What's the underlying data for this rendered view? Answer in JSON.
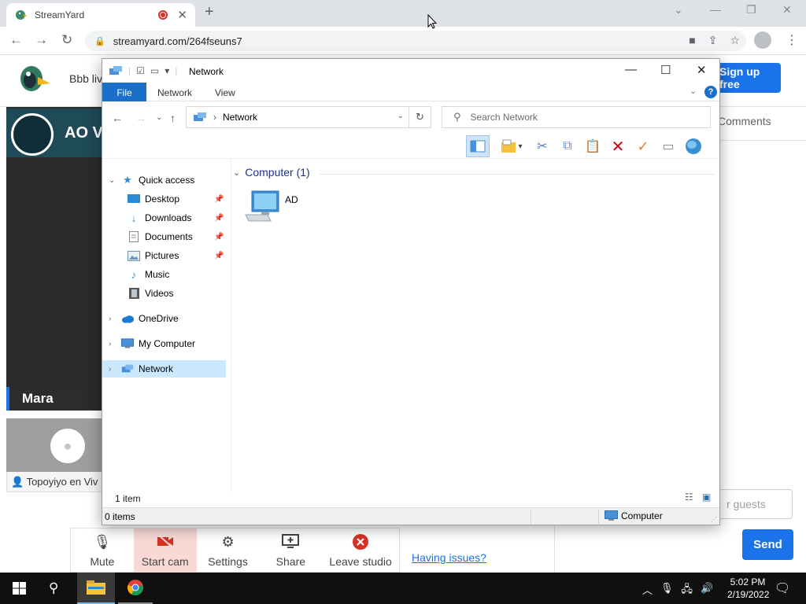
{
  "browser": {
    "tab_title": "StreamYard",
    "url": "streamyard.com/264fseuns7",
    "new_tab": "+",
    "close_tab": "✕"
  },
  "page": {
    "broadcast_name": "Bbb liv",
    "signup_label": "Sign up free",
    "stage_banner_text": "AO V",
    "presenter_name": "Mara",
    "guest_name": "Topoyiyo en Viv",
    "comments_label": "Comments",
    "guest_input_placeholder": "r guests",
    "send_label": "Send",
    "having_issues": "Having issues?",
    "controls": [
      {
        "label": "Mute",
        "icon": "microphone-icon"
      },
      {
        "label": "Start cam",
        "icon": "camera-off-icon"
      },
      {
        "label": "Settings",
        "icon": "gear-icon"
      },
      {
        "label": "Share",
        "icon": "share-screen-icon"
      },
      {
        "label": "Leave studio",
        "icon": "leave-icon"
      }
    ]
  },
  "explorer": {
    "title": "Network",
    "ribbon_tabs": [
      "File",
      "Network",
      "View"
    ],
    "address": "Network",
    "search_placeholder": "Search Network",
    "nav": [
      {
        "label": "Quick access",
        "icon": "star-icon"
      },
      {
        "label": "Desktop",
        "icon": "desktop-icon",
        "pinned": true
      },
      {
        "label": "Downloads",
        "icon": "download-icon",
        "pinned": true
      },
      {
        "label": "Documents",
        "icon": "documents-icon",
        "pinned": true
      },
      {
        "label": "Pictures",
        "icon": "pictures-icon",
        "pinned": true
      },
      {
        "label": "Music",
        "icon": "music-icon"
      },
      {
        "label": "Videos",
        "icon": "videos-icon"
      },
      {
        "label": "OneDrive",
        "icon": "cloud-icon"
      },
      {
        "label": "My Computer",
        "icon": "computer-icon"
      },
      {
        "label": "Network",
        "icon": "network-icon"
      }
    ],
    "group_header": "Computer (1)",
    "items": [
      {
        "label": "AD",
        "icon": "computer-icon"
      }
    ],
    "item_count": "1 item",
    "status_selected": "0 items",
    "status_location": "Computer"
  },
  "taskbar": {
    "time": "5:02 PM",
    "date": "2/19/2022"
  },
  "colors": {
    "accent": "#1a73e8",
    "explorer_file_tab": "#1a6fc9",
    "selection": "#cce8ff"
  }
}
